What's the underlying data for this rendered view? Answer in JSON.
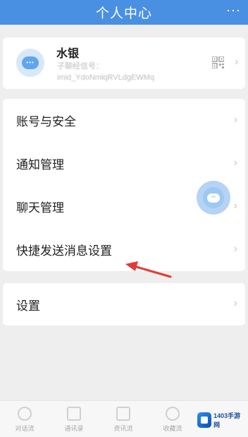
{
  "header": {
    "title": "个人中心",
    "more_label": "···"
  },
  "profile": {
    "name": "水银",
    "line1": "子聊经信号：",
    "line2": "imid_YdoNmlqRVLdgEWMq",
    "avatar_icon": "chat-bubble-icon",
    "qr_icon": "qr-code-icon"
  },
  "menu": {
    "items": [
      {
        "label": "账号与安全"
      },
      {
        "label": "通知管理"
      },
      {
        "label": "聊天管理"
      },
      {
        "label": "快捷发送消息设置"
      }
    ],
    "settings_label": "设置",
    "chevron": "›"
  },
  "tabbar": {
    "tabs": [
      {
        "label": "对话流",
        "icon": "chat-tab-icon"
      },
      {
        "label": "通讯录",
        "icon": "contacts-tab-icon"
      },
      {
        "label": "资讯流",
        "icon": "news-tab-icon"
      },
      {
        "label": "收藏流",
        "icon": "favorites-tab-icon"
      }
    ]
  },
  "watermark": {
    "text": "1403手游网"
  },
  "colors": {
    "header_bg": "#4a90e2",
    "page_bg": "#eeeeee",
    "arrow": "#e53935"
  }
}
